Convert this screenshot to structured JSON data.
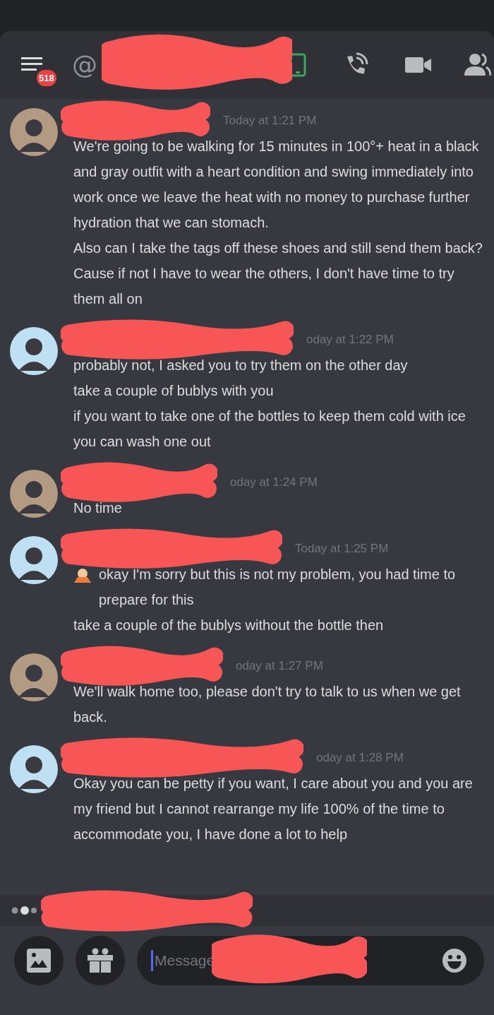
{
  "header": {
    "menu_badge": "518",
    "at_symbol": "@",
    "title_redacted": true
  },
  "messages": [
    {
      "color": "#b39a82",
      "author_redacted": true,
      "timestamp": "Today at 1:21 PM",
      "paragraphs": [
        {
          "text": "We're going to be walking for 15 minutes in 100°+ heat in a black and gray outfit with a heart condition and swing immediately into work once we leave the heat with no money to purchase further hydration that we can stomach."
        },
        {
          "text": "Also can I take the tags off these shoes and still send them back?"
        },
        {
          "text": "Cause if not I have to wear the others, I don't have time to try them all on"
        }
      ]
    },
    {
      "color": "#bfe0f2",
      "author_redacted": true,
      "timestamp": "oday at 1:22 PM",
      "paragraphs": [
        {
          "text": "probably not, I asked you to try them on the other day"
        },
        {
          "text": "take a couple of bublys with you"
        },
        {
          "text": "if you want to take one of the bottles to keep them cold with ice you can wash one out"
        }
      ]
    },
    {
      "color": "#b39a82",
      "author_redacted": true,
      "timestamp": "oday at 1:24 PM",
      "paragraphs": [
        {
          "text": "No time"
        }
      ]
    },
    {
      "color": "#bfe0f2",
      "author_redacted": true,
      "timestamp": "Today at 1:25 PM",
      "paragraphs": [
        {
          "text": "okay I'm sorry but this is not my problem, you had time to prepare for this",
          "emoji": true
        },
        {
          "text": "take a couple of the bublys without the bottle then"
        }
      ]
    },
    {
      "color": "#b39a82",
      "author_redacted": true,
      "timestamp": "oday at 1:27 PM",
      "paragraphs": [
        {
          "text": "We'll walk home too, please don't try to talk to us when we get back."
        }
      ]
    },
    {
      "color": "#bfe0f2",
      "author_redacted": true,
      "timestamp": "oday at 1:28 PM",
      "paragraphs": [
        {
          "text": "Okay you can be petty if you want, I care about you and you are my friend but I cannot rearrange my life 100% of the time to accommodate you, I have done a lot to help"
        }
      ]
    }
  ],
  "typing": {
    "redacted": true
  },
  "composer": {
    "placeholder": "Message",
    "redacted": true
  }
}
